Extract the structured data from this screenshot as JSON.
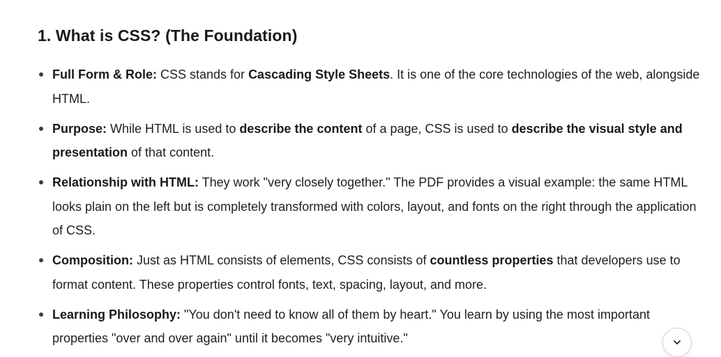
{
  "heading": "1. What is CSS? (The Foundation)",
  "items": [
    {
      "label": "Full Form & Role:",
      "t1": " CSS stands for ",
      "b1": "Cascading Style Sheets",
      "t2": ". It is one of the core technologies of the web, alongside HTML."
    },
    {
      "label": "Purpose:",
      "t1": " While HTML is used to ",
      "b1": "describe the content",
      "t2": " of a page, CSS is used to ",
      "b2": "describe the visual style and presentation",
      "t3": " of that content."
    },
    {
      "label": "Relationship with HTML:",
      "t1": " They work \"very closely together.\" The PDF provides a visual example: the same HTML looks plain on the left but is completely transformed with colors, layout, and fonts on the right through the application of CSS."
    },
    {
      "label": "Composition:",
      "t1": " Just as HTML consists of elements, CSS consists of ",
      "b1": "countless properties",
      "t2": " that developers use to format content. These properties control fonts, text, spacing, layout, and more."
    },
    {
      "label": "Learning Philosophy:",
      "t1": " \"You don't need to know all of them by heart.\" You learn by using the most important properties \"over and over again\" until it becomes \"very intuitive.\""
    }
  ],
  "scroll_button": {
    "icon": "chevron-down-icon"
  }
}
